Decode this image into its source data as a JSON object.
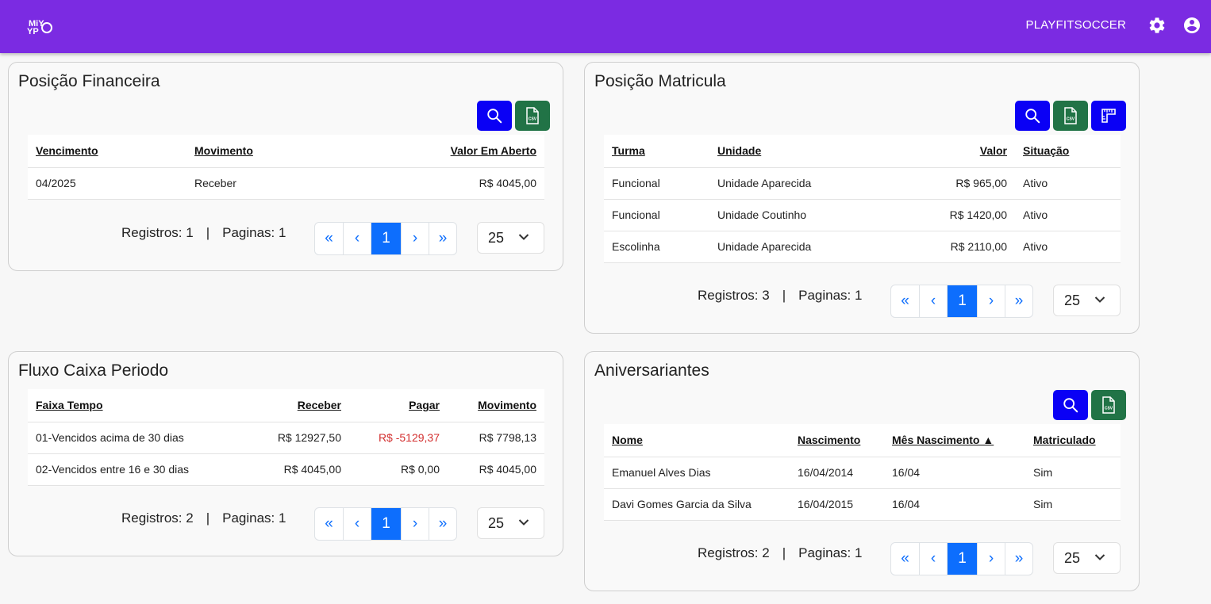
{
  "header": {
    "logo_top": "MiY",
    "logo_bottom": "YP",
    "user": "PLAYFITSOCCER",
    "icons": [
      "gear-icon",
      "account-circle-icon"
    ],
    "accent": "#7b2be2"
  },
  "financeira": {
    "title": "Posição Financeira",
    "buttons": [
      "search-icon",
      "csv-icon"
    ],
    "columns": [
      "Vencimento",
      "Movimento",
      "Valor Em Aberto"
    ],
    "rows": [
      [
        "04/2025",
        "Receber",
        "R$ 4045,00"
      ]
    ],
    "pager": {
      "registros": "Registros: 1",
      "sep": "|",
      "paginas": "Paginas: 1",
      "first": "«",
      "prev": "‹",
      "current": "1",
      "next": "›",
      "last": "»",
      "size": "25"
    }
  },
  "matricula": {
    "title": "Posição Matricula",
    "buttons": [
      "search-icon",
      "csv-icon",
      "ruler-icon"
    ],
    "columns": [
      "Turma",
      "Unidade",
      "Valor",
      "Situação"
    ],
    "rows": [
      [
        "Funcional",
        "Unidade Aparecida",
        "R$ 965,00",
        "Ativo"
      ],
      [
        "Funcional",
        "Unidade Coutinho",
        "R$ 1420,00",
        "Ativo"
      ],
      [
        "Escolinha",
        "Unidade Aparecida",
        "R$ 2110,00",
        "Ativo"
      ]
    ],
    "pager": {
      "registros": "Registros: 3",
      "sep": "|",
      "paginas": "Paginas: 1",
      "first": "«",
      "prev": "‹",
      "current": "1",
      "next": "›",
      "last": "»",
      "size": "25"
    }
  },
  "fluxo": {
    "title": "Fluxo Caixa Periodo",
    "columns": [
      "Faixa Tempo",
      "Receber",
      "Pagar",
      "Movimento"
    ],
    "rows": [
      [
        "01-Vencidos acima de 30 dias",
        "R$ 12927,50",
        "R$ -5129,37",
        "R$ 7798,13"
      ],
      [
        "02-Vencidos entre 16 e 30 dias",
        "R$ 4045,00",
        "R$ 0,00",
        "R$ 4045,00"
      ]
    ],
    "negative_color": "#d32f2f",
    "pager": {
      "registros": "Registros: 2",
      "sep": "|",
      "paginas": "Paginas: 1",
      "first": "«",
      "prev": "‹",
      "current": "1",
      "next": "›",
      "last": "»",
      "size": "25"
    }
  },
  "aniversariantes": {
    "title": "Aniversariantes",
    "buttons": [
      "search-icon",
      "csv-icon"
    ],
    "columns": [
      "Nome",
      "Nascimento",
      "Mês Nascimento ▲",
      "Matriculado"
    ],
    "rows": [
      [
        "Emanuel Alves Dias",
        "16/04/2014",
        "16/04",
        "Sim"
      ],
      [
        "Davi Gomes Garcia da Silva",
        "16/04/2015",
        "16/04",
        "Sim"
      ]
    ],
    "pager": {
      "registros": "Registros: 2",
      "sep": "|",
      "paginas": "Paginas: 1",
      "first": "«",
      "prev": "‹",
      "current": "1",
      "next": "›",
      "last": "»",
      "size": "25"
    }
  }
}
